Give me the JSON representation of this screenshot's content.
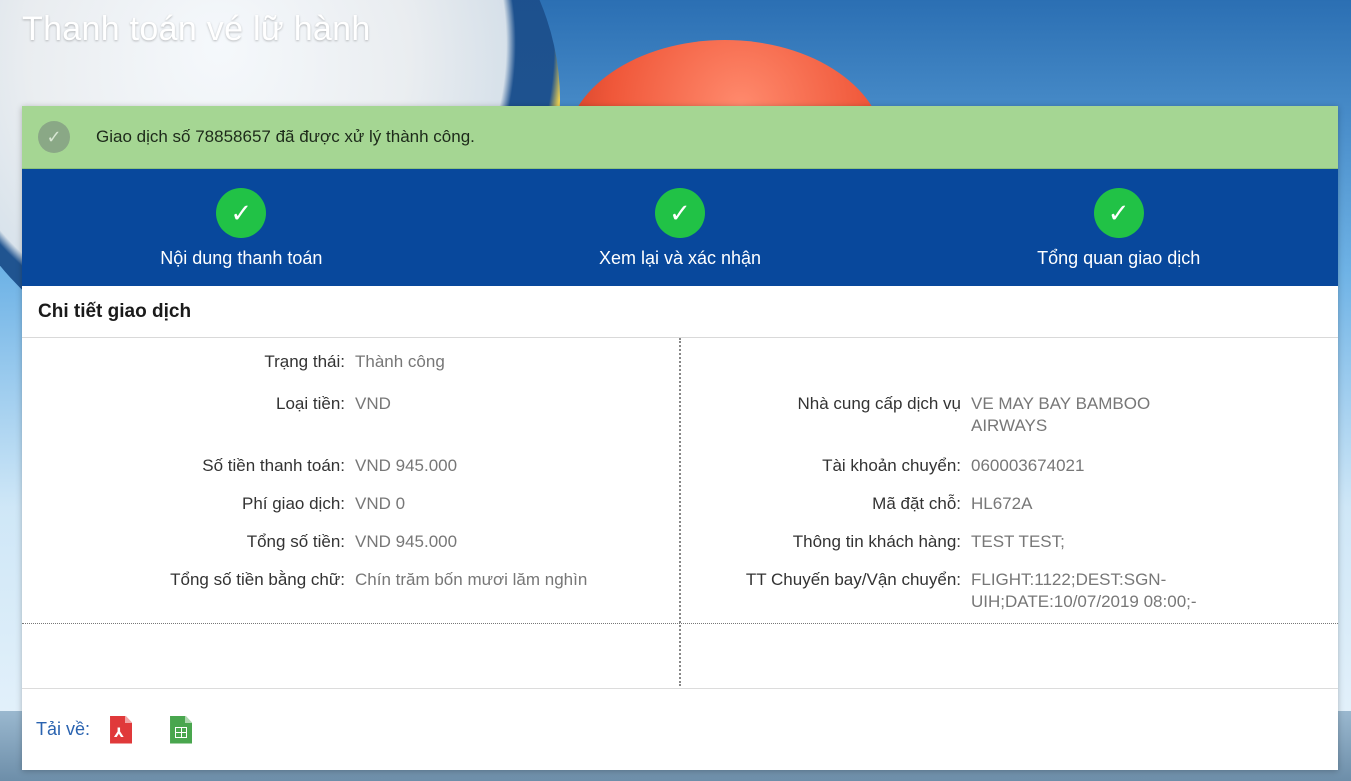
{
  "page": {
    "title": "Thanh toán vé lữ hành"
  },
  "alert": {
    "icon": "check-circle-icon",
    "text": "Giao dịch số 78858657 đã được xử lý thành công."
  },
  "steps": [
    {
      "icon": "check-icon",
      "label": "Nội dung thanh toán"
    },
    {
      "icon": "check-icon",
      "label": "Xem lại và xác nhận"
    },
    {
      "icon": "check-icon",
      "label": "Tổng quan giao dịch"
    }
  ],
  "section": {
    "title": "Chi tiết giao dịch"
  },
  "details_left": [
    {
      "label": "Trạng thái:",
      "value": "Thành công"
    },
    {
      "label": "Loại tiền:",
      "value": "VND"
    },
    {
      "label": "Số tiền thanh toán:",
      "value": "VND 945.000"
    },
    {
      "label": "Phí giao dịch:",
      "value": "VND 0"
    },
    {
      "label": "Tổng số tiền:",
      "value": "VND 945.000"
    },
    {
      "label": "Tổng số tiền bằng chữ:",
      "value": "Chín trăm bốn mươi lăm nghìn"
    }
  ],
  "details_right": [
    {
      "label": "Nhà cung cấp dịch vụ",
      "value": "VE MAY BAY BAMBOO AIRWAYS"
    },
    {
      "label": "Tài khoản chuyển:",
      "value": "060003674021"
    },
    {
      "label": "Mã đặt chỗ:",
      "value": "HL672A"
    },
    {
      "label": "Thông tin khách hàng:",
      "value": "TEST TEST;"
    },
    {
      "label": "TT Chuyến bay/Vận chuyển:",
      "value": "FLIGHT:1122;DEST:SGN-UIH;DATE:10/07/2019 08:00;-"
    }
  ],
  "download": {
    "label": "Tải về:",
    "pdf_icon": "pdf-file-icon",
    "excel_icon": "excel-file-icon"
  },
  "colors": {
    "accent": "#08489c",
    "success": "#21c246",
    "alert_bg": "#a5d693",
    "link": "#2a63b0"
  }
}
